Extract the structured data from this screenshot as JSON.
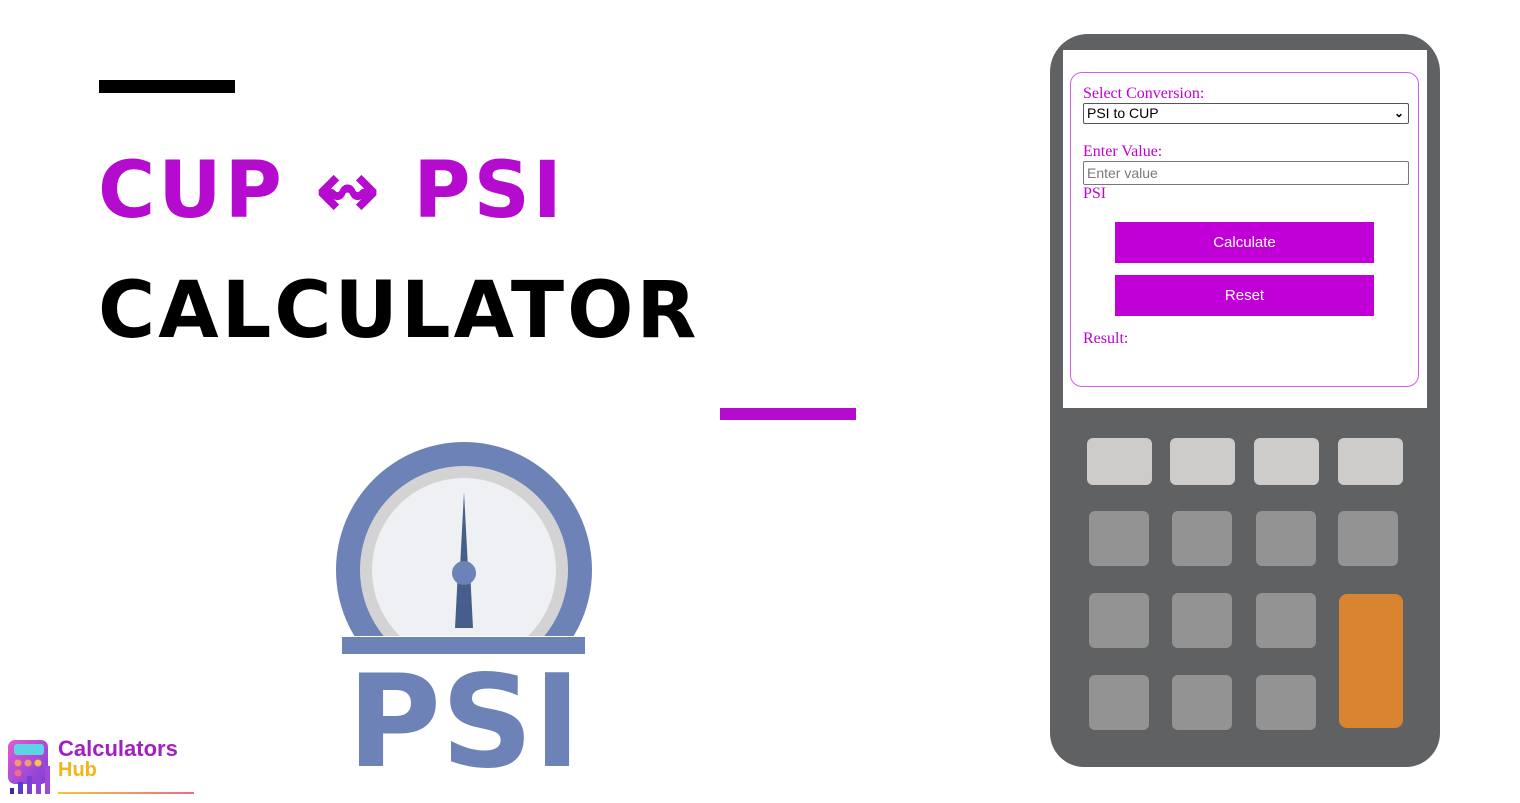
{
  "header": {
    "title_line_1": "CUP ↭ PSI",
    "title_line_2": "CALCULATOR"
  },
  "illustration": {
    "gauge_label": "PSI"
  },
  "brand": {
    "name_line_1": "Calculators",
    "name_line_2": "Hub"
  },
  "calculator": {
    "select_label": "Select Conversion:",
    "select_value": "PSI to CUP",
    "value_label": "Enter Value:",
    "value_placeholder": "Enter value",
    "value": "",
    "unit_label": "PSI",
    "calculate_label": "Calculate",
    "reset_label": "Reset",
    "result_label": "Result:"
  },
  "colors": {
    "accent": "#b50bcf",
    "button": "#c000d6",
    "calculator_body": "#606163",
    "key_light": "#cdccca",
    "key_mid": "#939393",
    "key_orange": "#d98430",
    "gauge_blue": "#6d83b8"
  }
}
